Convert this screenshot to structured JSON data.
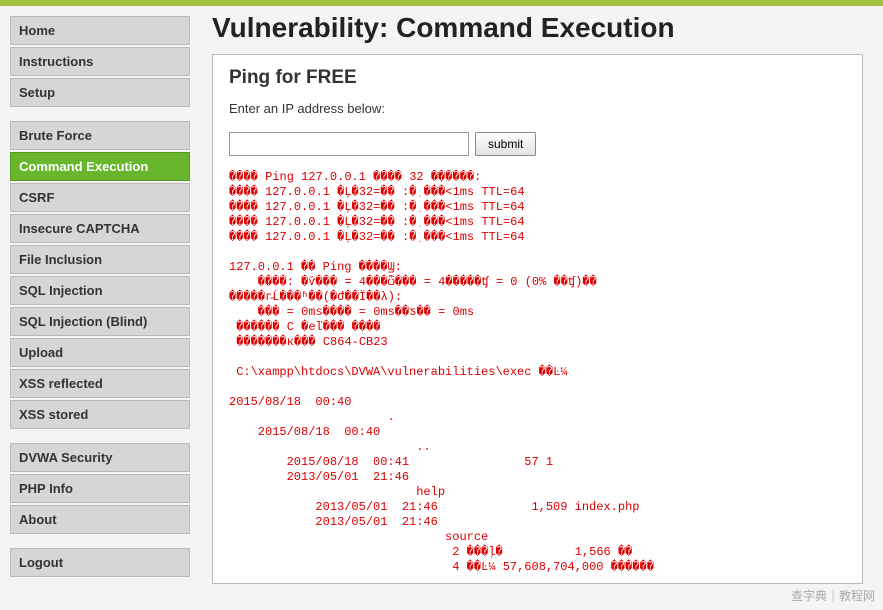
{
  "page": {
    "title": "Vulnerability: Command Execution"
  },
  "sidebar": {
    "groups": [
      {
        "items": [
          {
            "label": "Home",
            "active": false
          },
          {
            "label": "Instructions",
            "active": false
          },
          {
            "label": "Setup",
            "active": false
          }
        ]
      },
      {
        "items": [
          {
            "label": "Brute Force",
            "active": false
          },
          {
            "label": "Command Execution",
            "active": true
          },
          {
            "label": "CSRF",
            "active": false
          },
          {
            "label": "Insecure CAPTCHA",
            "active": false
          },
          {
            "label": "File Inclusion",
            "active": false
          },
          {
            "label": "SQL Injection",
            "active": false
          },
          {
            "label": "SQL Injection (Blind)",
            "active": false
          },
          {
            "label": "Upload",
            "active": false
          },
          {
            "label": "XSS reflected",
            "active": false
          },
          {
            "label": "XSS stored",
            "active": false
          }
        ]
      },
      {
        "items": [
          {
            "label": "DVWA Security",
            "active": false
          },
          {
            "label": "PHP Info",
            "active": false
          },
          {
            "label": "About",
            "active": false
          }
        ]
      },
      {
        "items": [
          {
            "label": "Logout",
            "active": false
          }
        ]
      }
    ]
  },
  "panel": {
    "heading": "Ping for FREE",
    "instruction": "Enter an IP address below:",
    "ip_value": "",
    "ip_placeholder": "",
    "submit_label": "submit"
  },
  "output": "���� Ping 127.0.0.1 ���� 32 �ֽ�����:\n���� 127.0.0.1 �Ļ�32=�� :�ֽ ���<1ms TTL=64\n���� 127.0.0.1 �Ļ�32=�� :�ֽ ���<1ms TTL=64\n���� 127.0.0.1 �Ļ�32=�� :�ֽ ���<1ms TTL=64\n���� 127.0.0.1 �Ļ�32=�� :�ֽ ���<1ms TTL=64\n\n127.0.0.1 �� Ping ����Ϣ:\n    ����: �ѷ��� = 4���ѽ��� = 4�����ʧ = 0 (0% ��ʧ)��\n�����г̵Ĺ���ʱ��(�Ժ��Ϊ��λ):\n    ��� = 0ms���� = 0ms��ƽ�� = 0ms\n ������ C �еľ��� ����\n �������к��� C864-CB23\n\n C:\\xampp\\htdocs\\DVWA\\vulnerabilities\\exec ��Ŀ¼\n\n2015/08/18  00:40\n                      .\n    2015/08/18  00:40\n                          ..\n        2015/08/18  00:41                57 1\n        2013/05/01  21:46\n                          help\n            2013/05/01  21:46             1,509 index.php\n            2013/05/01  21:46\n                              source\n                               2 ���ļ�          1,566 ��\n                               4 ��Ŀ¼ 57,608,704,000 ������",
  "watermark": "查字典｜教程网"
}
